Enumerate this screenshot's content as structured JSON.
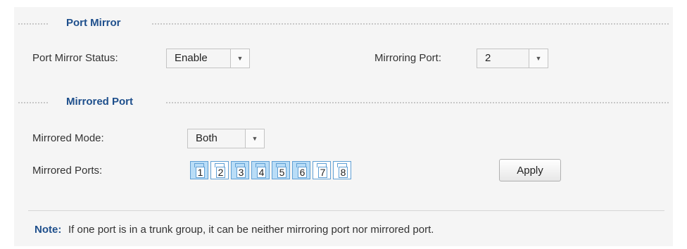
{
  "port_mirror": {
    "section_title": "Port Mirror",
    "status_label": "Port Mirror Status:",
    "status_value": "Enable",
    "mirroring_port_label": "Mirroring Port:",
    "mirroring_port_value": "2"
  },
  "mirrored_port": {
    "section_title": "Mirrored Port",
    "mode_label": "Mirrored Mode:",
    "mode_value": "Both",
    "ports_label": "Mirrored Ports:",
    "ports": [
      {
        "label": "1",
        "selected": true
      },
      {
        "label": "2",
        "selected": false
      },
      {
        "label": "3",
        "selected": true
      },
      {
        "label": "4",
        "selected": true
      },
      {
        "label": "5",
        "selected": true
      },
      {
        "label": "6",
        "selected": true
      },
      {
        "label": "7",
        "selected": false
      },
      {
        "label": "8",
        "selected": false
      }
    ],
    "apply_label": "Apply"
  },
  "note": {
    "label": "Note:",
    "text": "If one port is in a trunk group, it can be neither mirroring port nor mirrored port."
  },
  "icons": {
    "dropdown": "triangle-down-icon"
  },
  "colors": {
    "section_title": "#1e4f8c",
    "port_selected": "#b9ddf7",
    "port_border": "#5f9fd4",
    "panel_background": "#f5f5f5"
  }
}
